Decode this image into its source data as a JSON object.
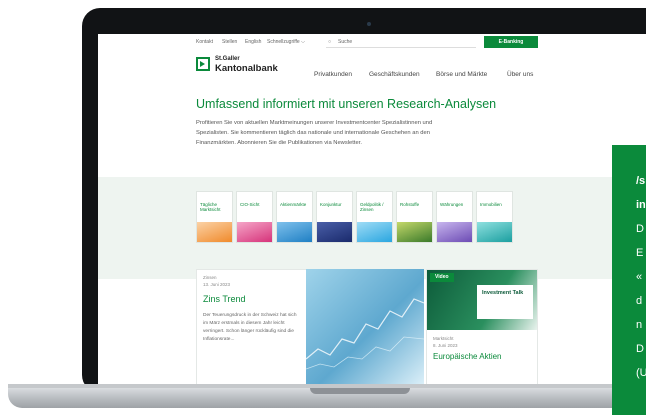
{
  "topbar": {
    "links": [
      "Kontakt",
      "Stellen",
      "English",
      "Schnellzugriffe ⌵"
    ],
    "search_placeholder": "Suche",
    "ebanking_label": "E-Banking"
  },
  "logo": {
    "line1": "St.Galler",
    "line2": "Kantonalbank"
  },
  "nav": [
    "Privatkunden",
    "Geschäftskunden",
    "Börse und Märkte",
    "Über uns"
  ],
  "headline": "Umfassend informiert mit unseren Research-Analysen",
  "intro": "Profitieren Sie von aktuellen Marktmeinungen unserer Investmentcenter Spezialistinnen und Spezialisten. Sie kommentieren täglich das nationale und internationale Geschehen an den Finanzmärkten. Abonnieren Sie die Publikationen via Newsletter.",
  "tiles": [
    {
      "label": "Tägliche Marktsicht",
      "color": "#f08a2b"
    },
    {
      "label": "CIO-Sicht",
      "color": "#d6337a"
    },
    {
      "label": "Aktienmärkte",
      "color": "#1f7fc4"
    },
    {
      "label": "Konjunktur",
      "color": "#1a2a6c"
    },
    {
      "label": "Geldpolitik / Zinsen",
      "color": "#2aa6e0"
    },
    {
      "label": "Rohstoffe",
      "color": "#3a7a2a"
    },
    {
      "label": "Währungen",
      "color": "#6c4bb4"
    },
    {
      "label": "Immobilien",
      "color": "#1b9fa0"
    }
  ],
  "card1": {
    "category": "Zinsen",
    "date": "13. Juni 2023",
    "title": "Zins Trend",
    "text": "Der Teuerungsdruck in der Schweiz hat sich im März erstmals in diesem Jahr leicht verringert. Schon länger rückläufig sind die Inflationsrate..."
  },
  "card3": {
    "badge": "Video",
    "talk_title": "Investment Talk",
    "category": "Marktsicht",
    "date": "8. Juni 2023",
    "title": "Europäische Aktien"
  },
  "overlay": {
    "lines": [
      "/s",
      "in",
      "D",
      "E",
      "«",
      "d",
      "n",
      "D",
      "(U"
    ]
  }
}
